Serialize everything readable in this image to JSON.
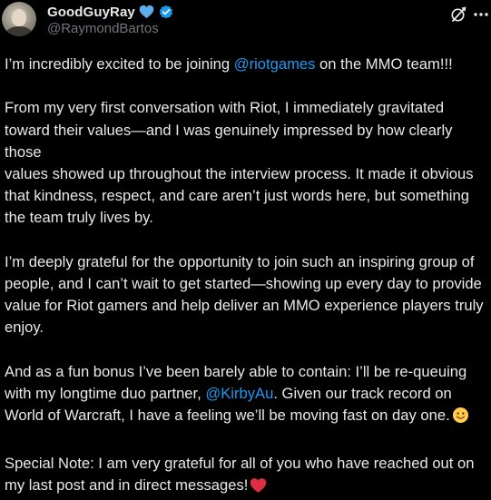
{
  "author": {
    "display_name": "GoodGuyRay",
    "handle": "@RaymondBartos"
  },
  "icons": {
    "name_emoji": "blue-heart-icon",
    "verified": "verified-badge-icon",
    "grok": "grok-icon",
    "more": "more-icon",
    "smile": "slightly-smiling-face-icon",
    "heart": "red-heart-icon"
  },
  "colors": {
    "background": "#000000",
    "text": "#e7e9ea",
    "secondary_text": "#71767b",
    "mention": "#1d9bf0",
    "verified": "#1d9bf0",
    "heart": "#e0245e"
  },
  "post": {
    "p1": {
      "before": "I’m incredibly excited to be joining ",
      "mention": "@riotgames",
      "after": " on the MMO team!!!"
    },
    "p2": {
      "line1": "From my very first conversation with Riot, I immediately gravitated",
      "line2": "toward their values—and I was genuinely impressed by how clearly those",
      "line3": "values showed up throughout the interview process. It made it obvious",
      "line4": "that kindness, respect, and care aren’t just words here, but something",
      "line5": "the team truly lives by."
    },
    "p3": {
      "line1": "I’m deeply grateful for the opportunity to join such an inspiring group of",
      "line2": "people, and I can’t wait to get started—showing up every day to provide",
      "line3": "value for Riot gamers and help deliver an MMO experience players truly",
      "line4": "enjoy."
    },
    "p4": {
      "line1": "And as a fun bonus I’ve been barely able to contain: I’ll be re-queuing",
      "line2_before": "with my longtime duo partner, ",
      "mention": "@KirbyAu",
      "line2_after": ". Given our track record on",
      "line3": "World of Warcraft, I have a feeling we’ll be moving fast on day one."
    },
    "p5": {
      "line1": "Special Note: I am very grateful for all of you who have reached out on",
      "line2": "my last post and in direct messages!"
    }
  }
}
